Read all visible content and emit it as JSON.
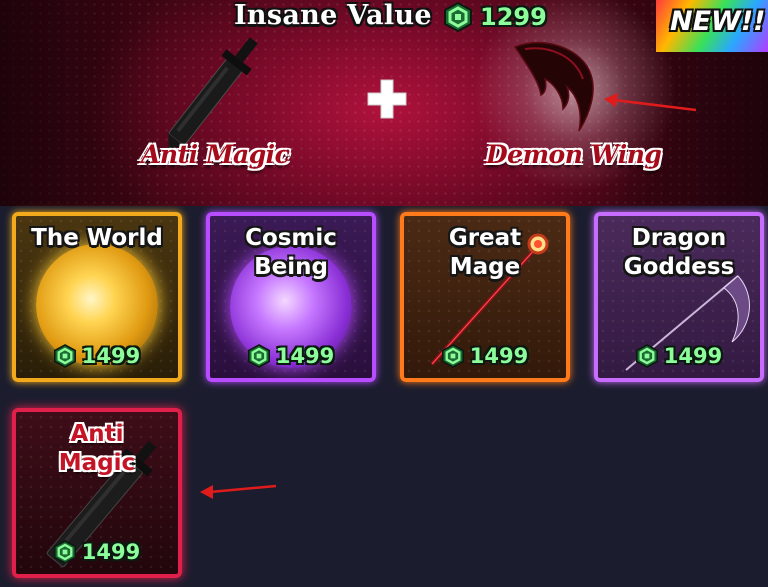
{
  "banner": {
    "title": "Insane Value",
    "price": "1299",
    "new_badge": "NEW!!",
    "item_left": "Anti Magic",
    "item_right": "Demon Wing"
  },
  "cards": [
    {
      "name": "The World",
      "price": "1499",
      "color": "#f2a91c"
    },
    {
      "name": "Cosmic Being",
      "price": "1499",
      "color": "#b74dff"
    },
    {
      "name": "Great Mage",
      "price": "1499",
      "color": "#ff7a1a"
    },
    {
      "name": "Dragon Goddess",
      "price": "1499",
      "color": "#c86cff"
    },
    {
      "name": "Anti Magic",
      "price": "1499",
      "color": "#e0204a"
    }
  ],
  "icons": {
    "currency": "robux-icon",
    "combine": "plus-icon",
    "annotation": "red-arrow-icon"
  },
  "colors": {
    "accent_green": "#8dfc9a",
    "annotation_red": "#e01b1b"
  }
}
